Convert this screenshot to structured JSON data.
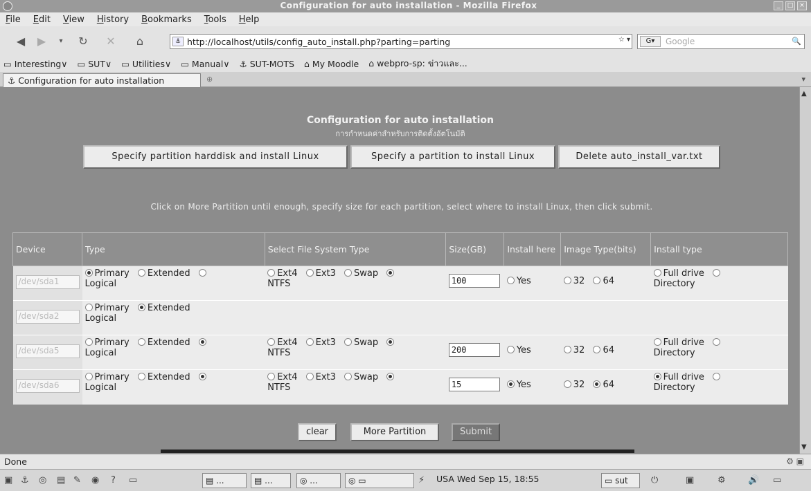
{
  "window": {
    "title": "Configuration for auto installation - Mozilla Firefox"
  },
  "menu": [
    "File",
    "Edit",
    "View",
    "History",
    "Bookmarks",
    "Tools",
    "Help"
  ],
  "navbar": {
    "url": "http://localhost/utils/config_auto_install.php?parting=parting",
    "search_placeholder": "Google"
  },
  "bookmarks": [
    "Interesting∨",
    "SUT∨",
    "Utilities∨",
    "Manual∨",
    "SUT-MOTS",
    "My Moodle",
    "webpro-sp: ข่าวและ..."
  ],
  "tab": {
    "label": "Configuration for auto installation"
  },
  "page": {
    "heading": "Configuration for auto installation",
    "subheading": "การกำหนดค่าสำหรับการติดตั้งอัตโนมัติ",
    "buttons": {
      "specify_harddisk": "Specify partition harddisk and install Linux",
      "specify_partition": "Specify a partition to install Linux",
      "delete_var": "Delete auto_install_var.txt"
    },
    "instructions": "Click on More Partition until enough, specify size for each partition, select where to install Linux, then click submit.",
    "table": {
      "headers": {
        "device": "Device",
        "type": "Type",
        "fs": "Select File System Type",
        "size": "Size(GB)",
        "install_here": "Install here",
        "image_type": "Image Type(bits)",
        "install_type": "Install type"
      },
      "labels": {
        "primary": "Primary",
        "extended": "Extended",
        "logical": "Logical",
        "ext4": "Ext4",
        "ext3": "Ext3",
        "swap": "Swap",
        "ntfs": "NTFS",
        "yes": "Yes",
        "b32": "32",
        "b64": "64",
        "full_drive": "Full drive",
        "directory": "Directory"
      },
      "rows": [
        {
          "device": "/dev/sda1",
          "size": "100"
        },
        {
          "device": "/dev/sda2"
        },
        {
          "device": "/dev/sda5",
          "size": "200"
        },
        {
          "device": "/dev/sda6",
          "size": "15"
        }
      ]
    },
    "bottom_buttons": {
      "clear": "clear",
      "more": "More Partition",
      "submit": "Submit"
    }
  },
  "status": {
    "text": "Done"
  },
  "taskbar": {
    "clock": "USA Wed Sep 15, 18:55",
    "user": "sut",
    "task_label": "..."
  }
}
